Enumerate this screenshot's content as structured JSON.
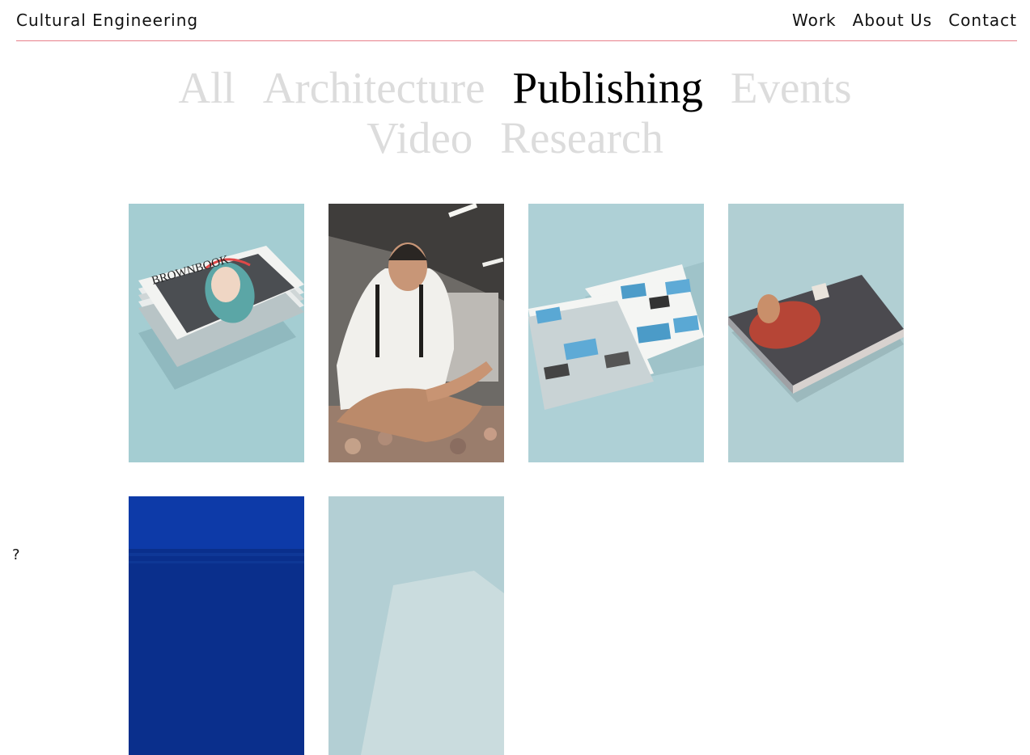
{
  "header": {
    "brand": "Cultural Engineering",
    "nav": [
      "Work",
      "About Us",
      "Contact"
    ]
  },
  "filters": {
    "row1": [
      "All",
      "Architecture",
      "Publishing",
      "Events"
    ],
    "row2": [
      "Video",
      "Research"
    ],
    "active": "Publishing"
  },
  "projects": [
    {
      "thumb": "magazine-stack-brownbook-thumbnail",
      "cover_text": "BROWNBOOK"
    },
    {
      "thumb": "seated-man-portrait-thumbnail"
    },
    {
      "thumb": "open-publications-thumbnail"
    },
    {
      "thumb": "dark-book-cover-thumbnail"
    },
    {
      "thumb": "blue-sea-thumbnail"
    },
    {
      "thumb": "pale-blue-publication-thumbnail"
    }
  ],
  "help": {
    "label": "?"
  },
  "colors": {
    "divider": "#e8808a",
    "inactive_filter": "#dcdcdc",
    "active_filter": "#000000",
    "backdrop": "#a9cdd3"
  }
}
